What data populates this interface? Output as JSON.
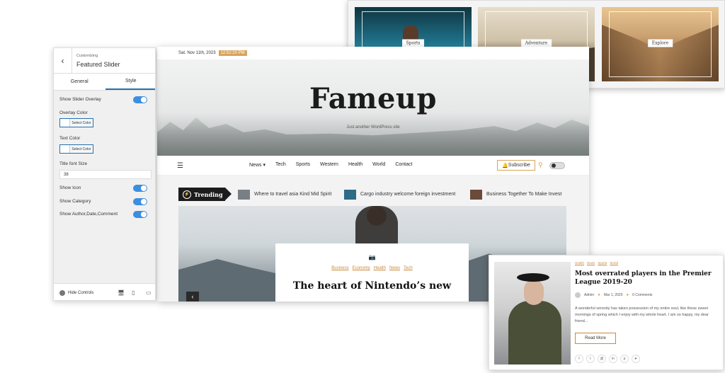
{
  "site": {
    "date": "Sat. Nov 11th, 2023",
    "time": "12:52:20 PM",
    "title": "Fameup",
    "tagline": "Just another WordPress site",
    "nav": [
      {
        "label": "News ▾"
      },
      {
        "label": "Tech"
      },
      {
        "label": "Sports"
      },
      {
        "label": "Western"
      },
      {
        "label": "Health"
      },
      {
        "label": "World"
      },
      {
        "label": "Contact"
      }
    ],
    "subscribe_label": "Subscribe",
    "trending_label": "Trending",
    "trending": [
      {
        "text": "Where to travel asia Kind Mid Spirit"
      },
      {
        "text": "Cargo industry welcome foreign investment"
      },
      {
        "text": "Business Together To Make Invest"
      }
    ],
    "featured": {
      "categories": [
        "Business",
        "Economy",
        "Health",
        "News",
        "Tech"
      ],
      "title": "The heart of Nintendo’s new"
    }
  },
  "customizer": {
    "subtitle": "Customizing",
    "title": "Featured Slider",
    "tabs": [
      {
        "label": "General"
      },
      {
        "label": "Style"
      }
    ],
    "show_slider_overlay": "Show Slider Overlay",
    "overlay_color": "Overlay Color",
    "text_color": "Text Color",
    "select_color": "Select Color",
    "title_font_size_label": "Title font Size",
    "title_font_size_value": "38",
    "show_icon": "Show Icon",
    "show_category": "Show Category",
    "show_author": "Show Author,Date,Comment",
    "hide_controls": "Hide Controls"
  },
  "slides": [
    {
      "label": "Sports"
    },
    {
      "label": "Adventure"
    },
    {
      "label": "Explore"
    }
  ],
  "blog": {
    "categories": [
      "Health",
      "News",
      "Sports",
      "World"
    ],
    "title": "Most overrated players in the Premier League 2019-20",
    "author": "Admin",
    "date": "Mar 1, 2020",
    "comments": "0 Comments",
    "excerpt": "A wonderful serenity has taken possession of my entire soul, like these sweet mornings of spring which I enjoy with my whole heart. I am so happy, my dear friend...",
    "read_more": "Read More"
  },
  "colors": {
    "accent": "#d9a35c",
    "toggle_on": "#3b8ee0",
    "dark": "#1c1c1c"
  }
}
